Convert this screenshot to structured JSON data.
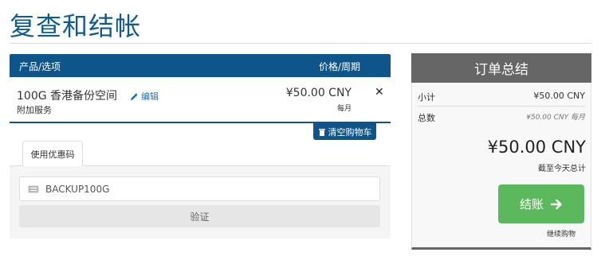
{
  "page": {
    "title": "复查和结帐"
  },
  "cart": {
    "header": {
      "product_col": "产品/选项",
      "price_col": "价格/周期"
    },
    "item": {
      "name": "100G 香港备份空间",
      "edit_label": "编辑",
      "subtitle": "附加服务",
      "price": "¥50.00 CNY",
      "cycle": "每月",
      "remove_icon": "close-icon"
    },
    "empty_cart_label": "清空购物车"
  },
  "promo": {
    "tab_label": "使用优惠码",
    "input_value": "BACKUP100G",
    "validate_label": "验证"
  },
  "summary": {
    "title": "订单总结",
    "subtotal_label": "小计",
    "subtotal_value": "¥50.00 CNY",
    "total_label": "总数",
    "total_value": "¥50.00 CNY 每月",
    "grand_total": "¥50.00 CNY",
    "grand_total_label": "截至今天总计",
    "checkout_label": "结账",
    "continue_label": "继续购物"
  },
  "colors": {
    "brand_blue": "#0e5589",
    "checkout_green": "#5cb85c",
    "summary_gray": "#666666"
  }
}
